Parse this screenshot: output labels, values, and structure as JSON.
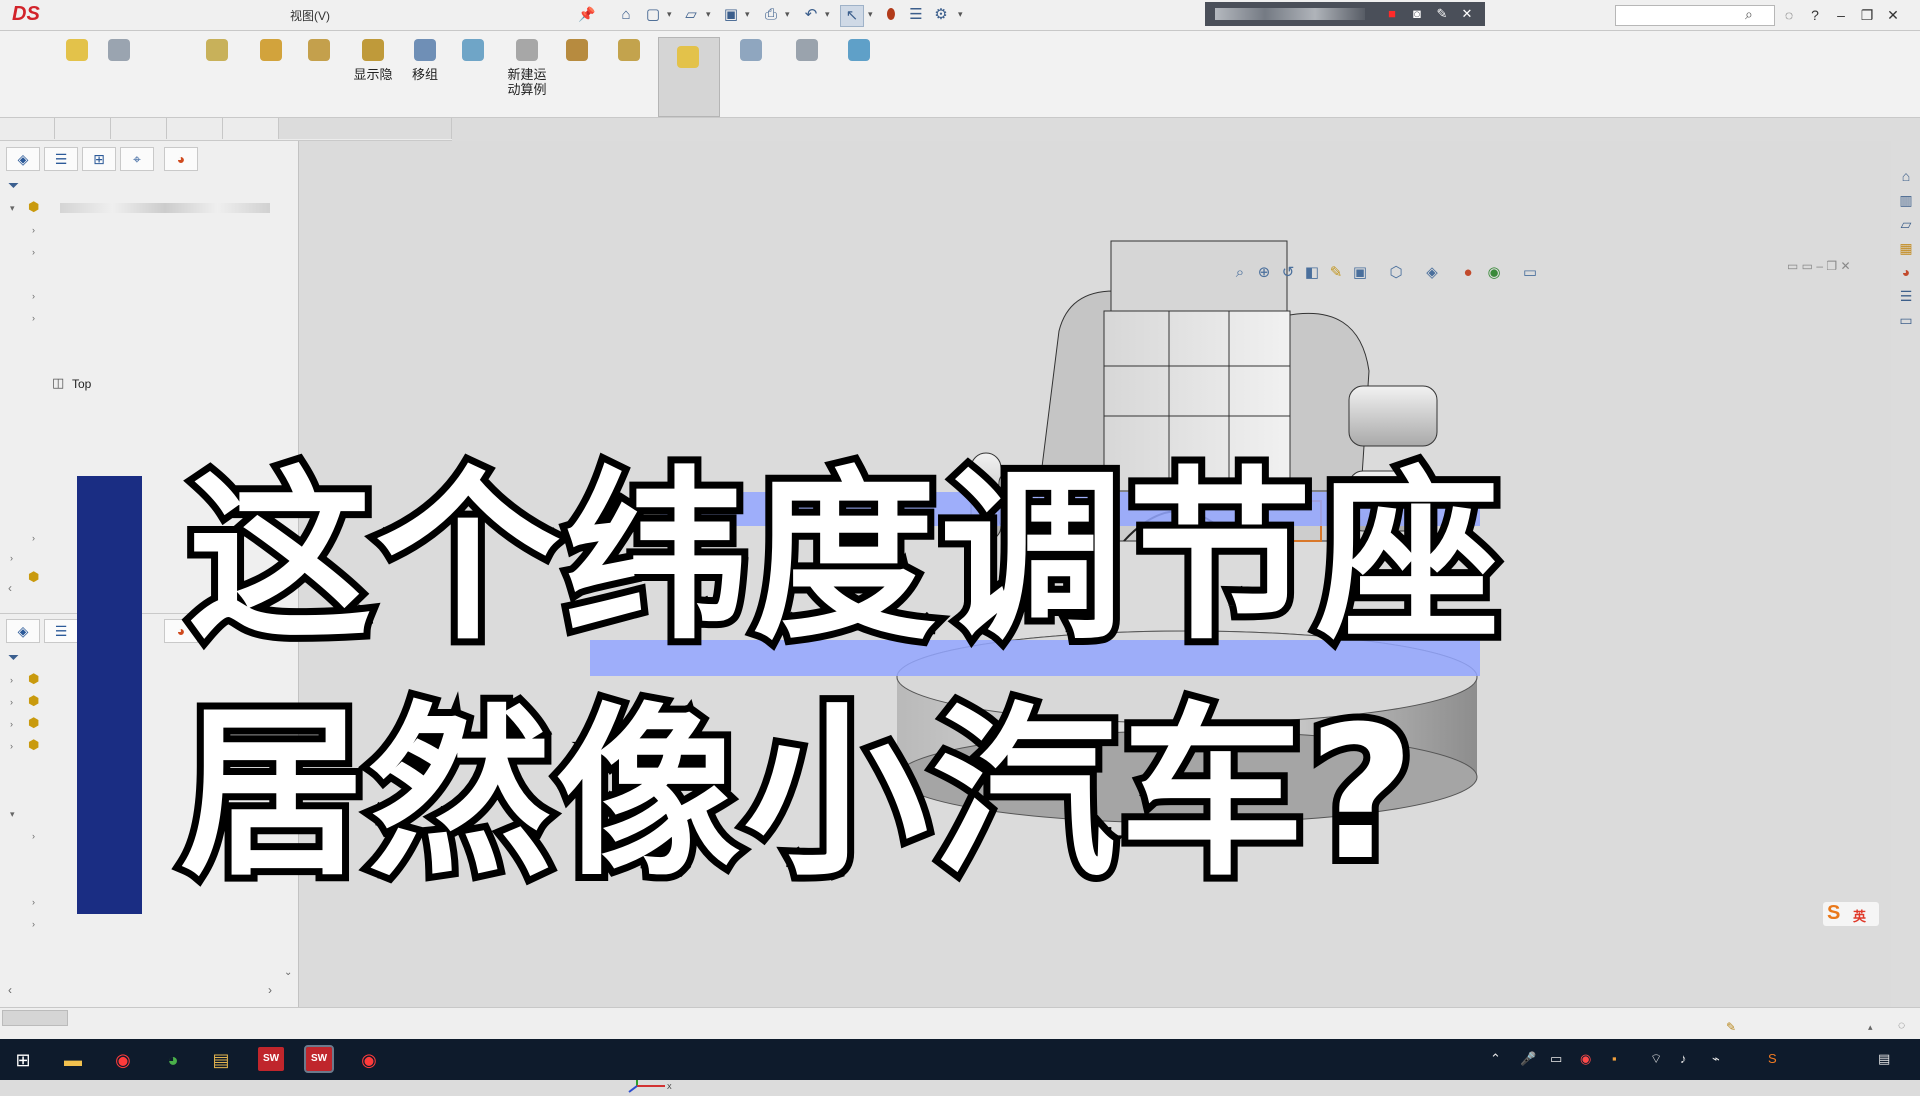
{
  "titlebar": {
    "menu_view": "视图(V)",
    "quick_access_icons": [
      "home-icon",
      "new-document-icon",
      "open-icon",
      "save-icon",
      "print-icon",
      "undo-icon",
      "select-icon",
      "rebuild-icon",
      "file-properties-icon",
      "options-icon"
    ],
    "record_controls": [
      "stop-record-icon",
      "camera-icon",
      "pen-icon",
      "close-icon"
    ],
    "window_controls": [
      "user-icon",
      "help-icon",
      "minimize-icon",
      "restore-icon",
      "close-icon"
    ]
  },
  "ribbon": {
    "labels": [
      "显示隐",
      "移组",
      "新建运\n动算例"
    ]
  },
  "tree": {
    "top_plane": "Top"
  },
  "overlay": {
    "line1": "这个纬度调节座",
    "line2": "居然像小汽车?"
  },
  "ime": {
    "label": "英"
  },
  "taskbar": {
    "sw_badge_1": "SW",
    "sw_badge_2": "SW"
  },
  "colors": {
    "overlay_fill": "#ffffff",
    "overlay_stroke": "#000000",
    "overlay_shadow": "#93a6ff",
    "left_bar": "#1a2d83",
    "taskbar": "#0e1b2c",
    "logo": "#d2232a"
  }
}
